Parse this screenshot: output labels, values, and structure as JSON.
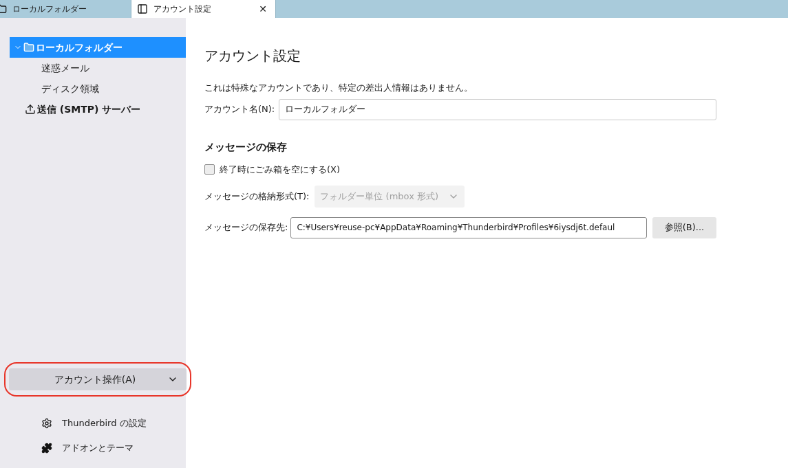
{
  "tabs": [
    {
      "label": "ローカルフォルダー",
      "kind": "folder",
      "selected": false,
      "closable": false
    },
    {
      "label": "アカウント設定",
      "kind": "settings",
      "selected": true,
      "closable": true
    }
  ],
  "tab_close": "✕",
  "sidebar": {
    "items": [
      {
        "label": "ローカルフォルダー",
        "kind": "folder",
        "selected": true,
        "expanded": true,
        "children": [
          {
            "label": "迷惑メール",
            "selected": false
          },
          {
            "label": "ディスク領域",
            "selected": false
          }
        ]
      },
      {
        "label": "送信 (SMTP) サーバー",
        "kind": "outbox",
        "selected": false
      }
    ],
    "account_actions": {
      "label": "アカウント操作(A)",
      "highlighted": true
    },
    "links": [
      {
        "label": "Thunderbird の設定",
        "kind": "gear"
      },
      {
        "label": "アドオンとテーマ",
        "kind": "puzzle"
      }
    ]
  },
  "main": {
    "title": "アカウント設定",
    "note": "これは特殊なアカウントであり、特定の差出人情報はありません。",
    "account_name": {
      "label": "アカウント名(N):",
      "value": "ローカルフォルダー"
    },
    "section": "メッセージの保存",
    "empty_trash": {
      "label": "終了時にごみ箱を空にする(X)",
      "checked": false
    },
    "store_type": {
      "label": "メッセージの格納形式(T):",
      "value": "フォルダー単位 (mbox 形式)",
      "disabled": true
    },
    "store_path": {
      "label": "メッセージの保存先:",
      "value": "C:¥Users¥reuse-pc¥AppData¥Roaming¥Thunderbird¥Profiles¥6iysdj6t.defaul",
      "button": "参照(B)..."
    }
  }
}
